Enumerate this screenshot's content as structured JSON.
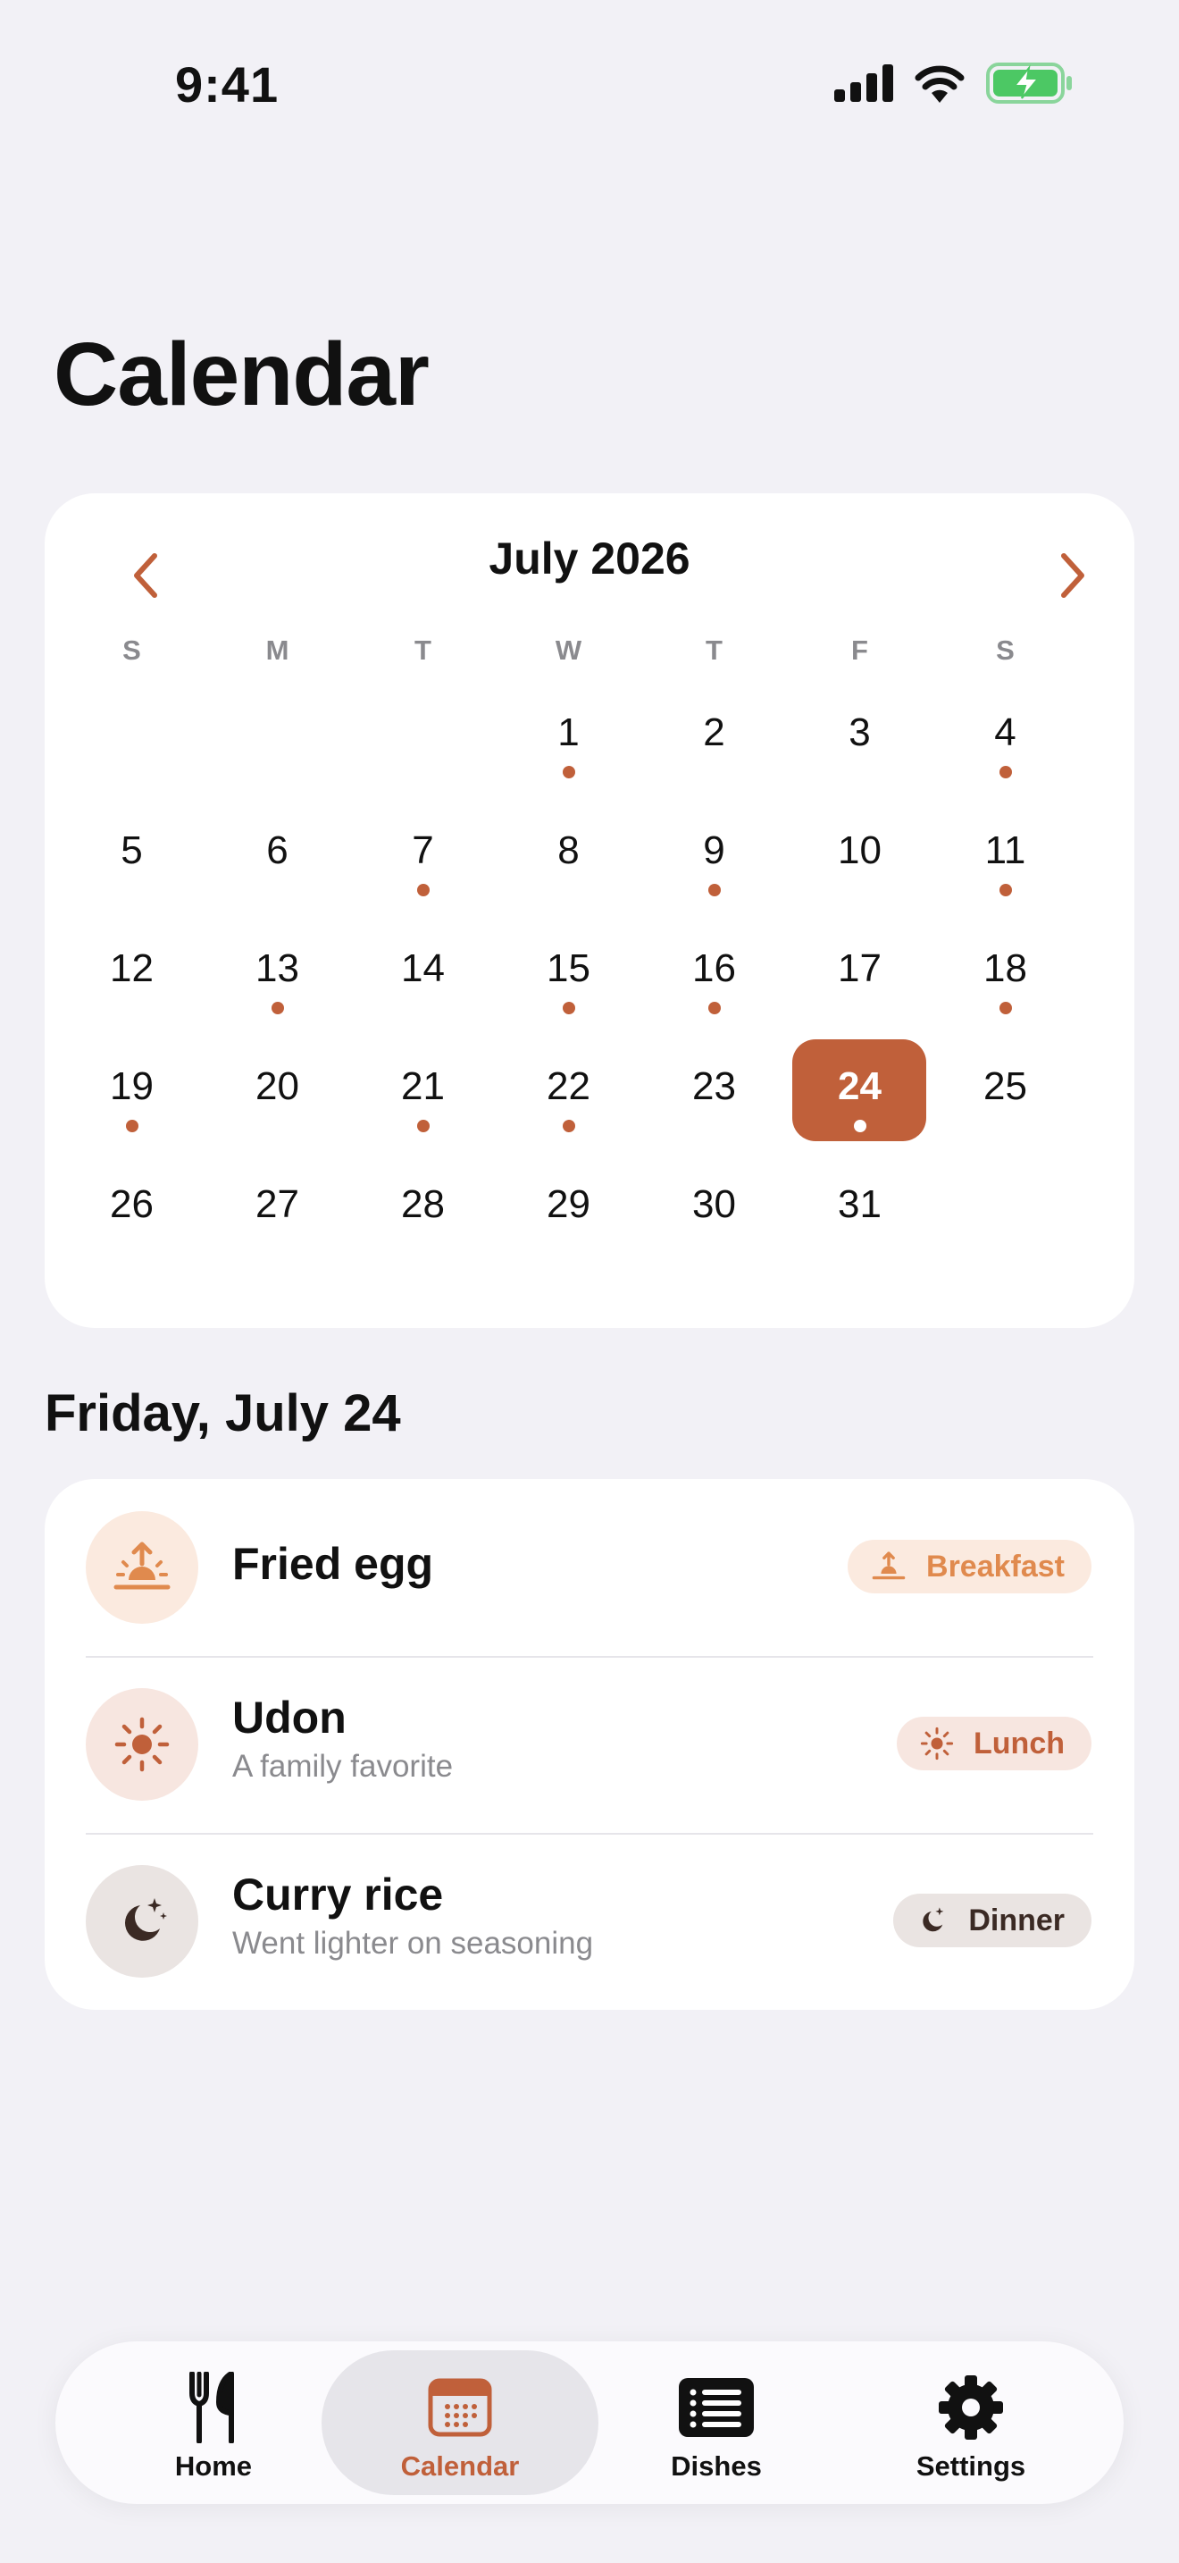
{
  "status_bar": {
    "time": "9:41"
  },
  "page": {
    "title": "Calendar"
  },
  "calendar": {
    "month_label": "July 2026",
    "weekdays": [
      "S",
      "M",
      "T",
      "W",
      "T",
      "F",
      "S"
    ],
    "leading_blanks": 3,
    "days": [
      {
        "d": "1",
        "dot": true
      },
      {
        "d": "2",
        "dot": false
      },
      {
        "d": "3",
        "dot": false
      },
      {
        "d": "4",
        "dot": true
      },
      {
        "d": "5",
        "dot": false
      },
      {
        "d": "6",
        "dot": false
      },
      {
        "d": "7",
        "dot": true
      },
      {
        "d": "8",
        "dot": false
      },
      {
        "d": "9",
        "dot": true
      },
      {
        "d": "10",
        "dot": false
      },
      {
        "d": "11",
        "dot": true
      },
      {
        "d": "12",
        "dot": false
      },
      {
        "d": "13",
        "dot": true
      },
      {
        "d": "14",
        "dot": false
      },
      {
        "d": "15",
        "dot": true
      },
      {
        "d": "16",
        "dot": true
      },
      {
        "d": "17",
        "dot": false
      },
      {
        "d": "18",
        "dot": true
      },
      {
        "d": "19",
        "dot": true
      },
      {
        "d": "20",
        "dot": false
      },
      {
        "d": "21",
        "dot": true
      },
      {
        "d": "22",
        "dot": true
      },
      {
        "d": "23",
        "dot": false
      },
      {
        "d": "24",
        "dot": true,
        "selected": true
      },
      {
        "d": "25",
        "dot": false
      },
      {
        "d": "26",
        "dot": false
      },
      {
        "d": "27",
        "dot": false
      },
      {
        "d": "28",
        "dot": false
      },
      {
        "d": "29",
        "dot": false
      },
      {
        "d": "30",
        "dot": false
      },
      {
        "d": "31",
        "dot": false
      }
    ]
  },
  "selected_date": {
    "heading": "Friday, July 24"
  },
  "meals": {
    "items": [
      {
        "name": "Fried egg",
        "note": "",
        "badge": "Breakfast",
        "icon": "sunrise-icon"
      },
      {
        "name": "Udon",
        "note": "A family favorite",
        "badge": "Lunch",
        "icon": "sun-icon"
      },
      {
        "name": "Curry rice",
        "note": "Went lighter on seasoning",
        "badge": "Dinner",
        "icon": "moon-stars-icon"
      }
    ]
  },
  "tabs": {
    "home": "Home",
    "calendar": "Calendar",
    "dishes": "Dishes",
    "settings": "Settings"
  },
  "colors": {
    "accent": "#C0603A",
    "breakfast": "#E08A4E",
    "lunch": "#C0603A",
    "dinner": "#3B2A24",
    "background": "#F2F1F6"
  }
}
